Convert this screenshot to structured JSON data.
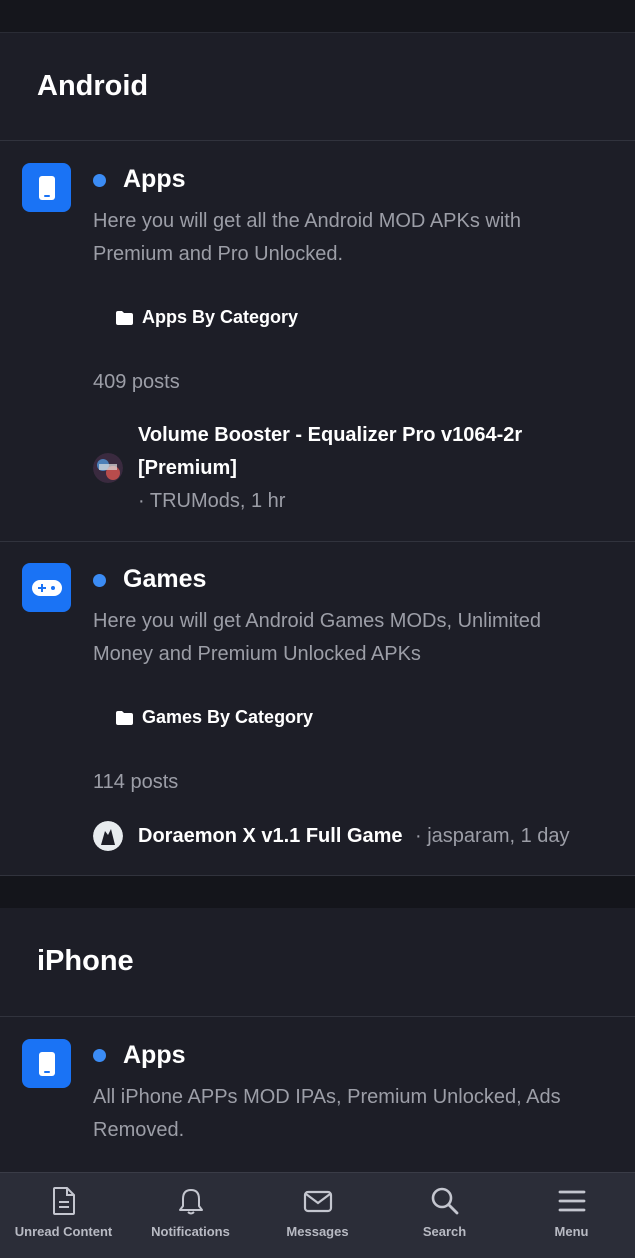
{
  "sections": [
    {
      "title": "Android",
      "forums": [
        {
          "title": "Apps",
          "description": "Here you will get all the Android MOD APKs with Premium and Pro Unlocked.",
          "subcategory": "Apps By Category",
          "posts": "409 posts",
          "latest_title": "Volume Booster - Equalizer Pro v1064-2r [Premium]",
          "latest_meta": "· TRUMods, 1 hr"
        },
        {
          "title": "Games",
          "description": "Here you will get Android Games MODs, Unlimited Money and Premium Unlocked APKs",
          "subcategory": "Games By Category",
          "posts": "114 posts",
          "latest_title": "Doraemon X v1.1 Full Game",
          "latest_meta": "· jasparam, 1 day"
        }
      ]
    },
    {
      "title": "iPhone",
      "forums": [
        {
          "title": "Apps",
          "description": "All iPhone APPs MOD IPAs, Premium Unlocked, Ads Removed."
        }
      ]
    }
  ],
  "nav": [
    {
      "label": "Unread Content",
      "icon": "document-icon"
    },
    {
      "label": "Notifications",
      "icon": "bell-icon"
    },
    {
      "label": "Messages",
      "icon": "envelope-icon"
    },
    {
      "label": "Search",
      "icon": "search-icon"
    },
    {
      "label": "Menu",
      "icon": "hamburger-icon"
    }
  ],
  "colors": {
    "accent": "#1a73f5",
    "unread_dot": "#3b8cf5",
    "background": "#1d1e27",
    "muted_text": "#9c9ea7"
  }
}
